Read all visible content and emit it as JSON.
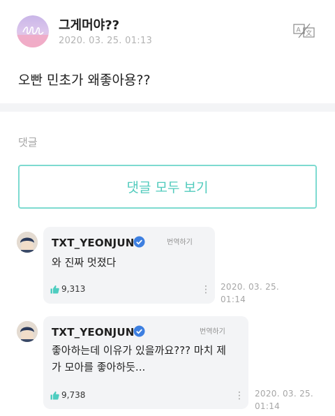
{
  "post": {
    "author": "그게머야??",
    "timestamp": "2020. 03. 25. 01:13",
    "body": "오빤 민초가 왜좋아용??",
    "translate_icon": "translate-icon"
  },
  "comments_section": {
    "label": "댓글",
    "view_all_label": "댓글 모두 보기"
  },
  "comments": [
    {
      "username": "TXT_YEONJUN",
      "verified": true,
      "translate_label": "번역하기",
      "text_lines": [
        "와 진짜 멋졌다"
      ],
      "likes": "9,313",
      "date": "2020. 03. 25.",
      "time": "01:14"
    },
    {
      "username": "TXT_YEONJUN",
      "verified": true,
      "translate_label": "번역하기",
      "text_lines": [
        "좋아하는데 이유가 있을까요??? 마치 제",
        "가 모아를 좋아하듯..."
      ],
      "likes": "9,738",
      "date": "2020. 03. 25.",
      "time": "01:14"
    }
  ],
  "colors": {
    "accent": "#52cbbd",
    "verified": "#3d7fe0",
    "bubble": "#f3f4f6"
  }
}
